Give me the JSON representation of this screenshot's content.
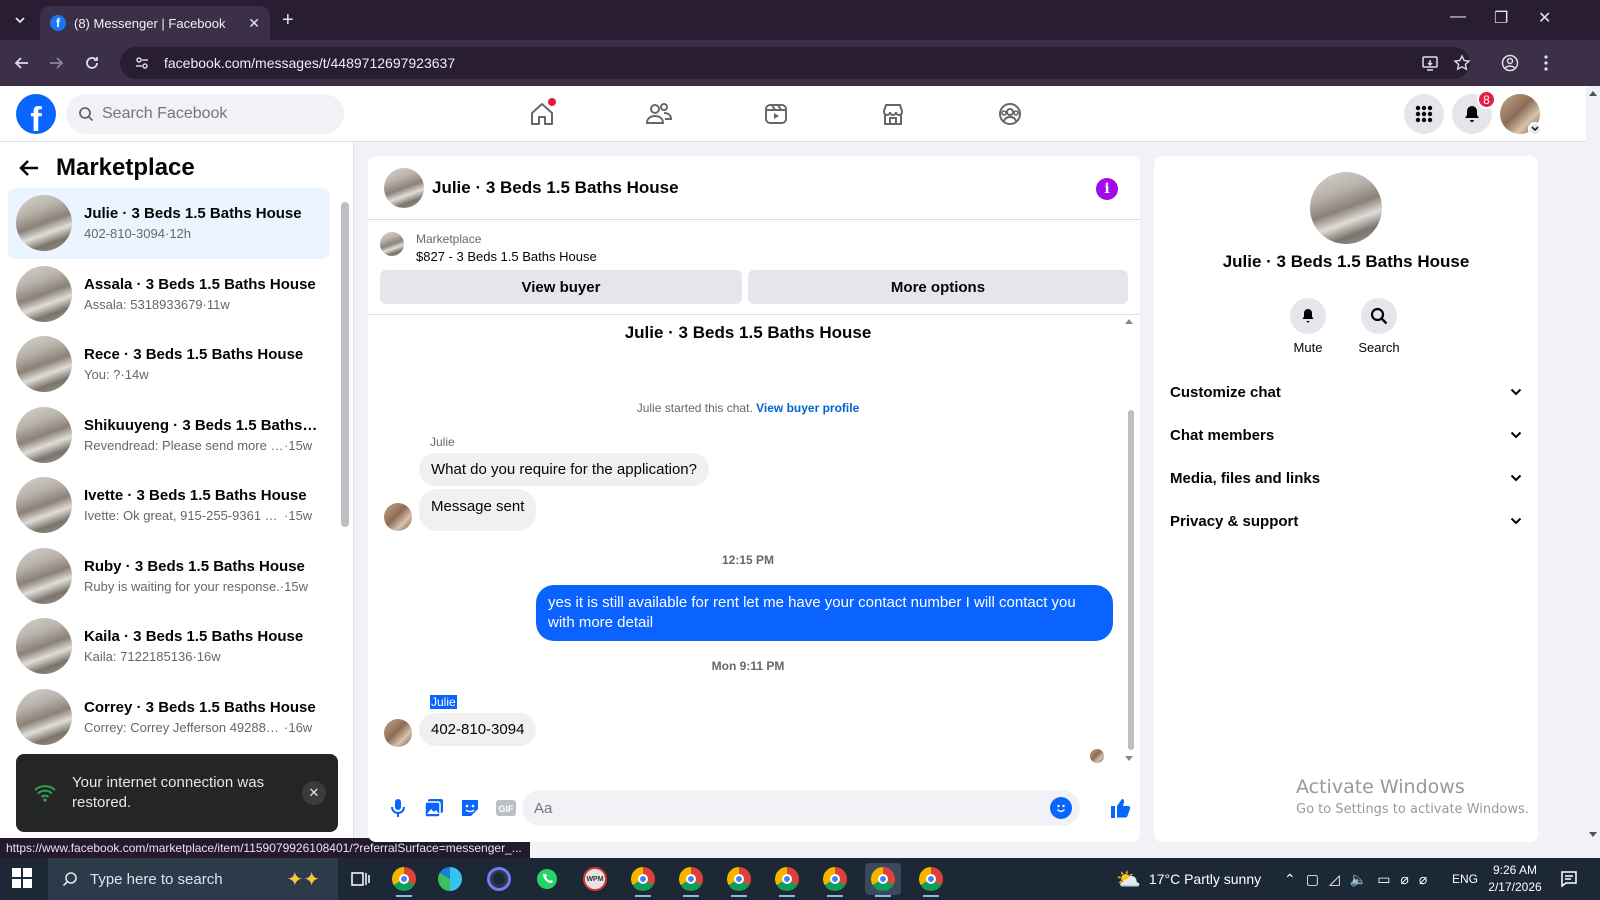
{
  "browser": {
    "tab_title": "(8) Messenger | Facebook",
    "url": "facebook.com/messages/t/4489712697923637",
    "status_url": "https://www.facebook.com/marketplace/item/1159079926108401/?referralSurface=messenger_..."
  },
  "header": {
    "search_placeholder": "Search Facebook",
    "notifications_count": "8",
    "nav_icons": [
      "home-icon",
      "friends-icon",
      "watch-icon",
      "marketplace-icon",
      "groups-icon"
    ]
  },
  "sidebar": {
    "title": "Marketplace",
    "conversations": [
      {
        "name": "Julie · 3 Beds 1.5 Baths House",
        "snippet": "402-810-3094",
        "time": "12h",
        "active": true
      },
      {
        "name": "Assala · 3 Beds 1.5 Baths House",
        "snippet": "Assala: 5318933679",
        "time": "11w"
      },
      {
        "name": "Rece · 3 Beds 1.5 Baths House",
        "snippet": "You: ?",
        "time": "14w"
      },
      {
        "name": "Shikuuyeng · 3 Beds 1.5 Baths H...",
        "snippet": "Revendread: Please send more de...",
        "time": "15w"
      },
      {
        "name": "Ivette · 3 Beds 1.5 Baths House",
        "snippet": "Ivette: Ok great, 915-255-9361 Th...",
        "time": "15w"
      },
      {
        "name": "Ruby · 3 Beds 1.5 Baths House",
        "snippet": "Ruby is waiting for your response.",
        "time": "15w"
      },
      {
        "name": "Kaila · 3 Beds 1.5 Baths House",
        "snippet": "Kaila: 7122185136",
        "time": "16w"
      },
      {
        "name": "Correy · 3 Beds 1.5 Baths House",
        "snippet": "Correy: Correy Jefferson 4928855...",
        "time": "16w"
      }
    ],
    "separator": "·"
  },
  "toast": {
    "text": "Your internet connection was restored."
  },
  "chat": {
    "title": "Julie · 3 Beds 1.5 Baths House",
    "marketplace_label": "Marketplace",
    "listing": "$827 - 3 Beds 1.5 Baths House",
    "view_buyer_label": "View buyer",
    "more_options_label": "More options",
    "thread_title": "Julie · 3 Beds 1.5 Baths House",
    "system_text": "Julie started this chat.",
    "system_link": "View buyer profile",
    "sender_1": "Julie",
    "msg_1": "What do you require for the application?",
    "msg_2": "Message sent",
    "time_1": "12:15 PM",
    "msg_out": "yes it is still available for rent let me have your contact number I will contact you with more detail",
    "time_2": "Mon 9:11 PM",
    "sender_2": "Julie",
    "msg_3": "402-810-3094",
    "composer_placeholder": "Aa"
  },
  "details": {
    "name": "Julie · 3 Beds 1.5 Baths House",
    "mute_label": "Mute",
    "search_label": "Search",
    "sections": [
      "Customize chat",
      "Chat members",
      "Media, files and links",
      "Privacy & support"
    ]
  },
  "watermark": {
    "line1": "Activate Windows",
    "line2": "Go to Settings to activate Windows."
  },
  "taskbar": {
    "search_placeholder": "Type here to search",
    "weather": "17°C  Partly sunny",
    "language": "ENG",
    "time": "9:26 AM",
    "date": "2/17/2026"
  },
  "colors": {
    "brand": "#0866ff",
    "outgoing_bubble": "#0a62ff",
    "active_conv": "#ebf5ff",
    "info": "#a109e6"
  }
}
